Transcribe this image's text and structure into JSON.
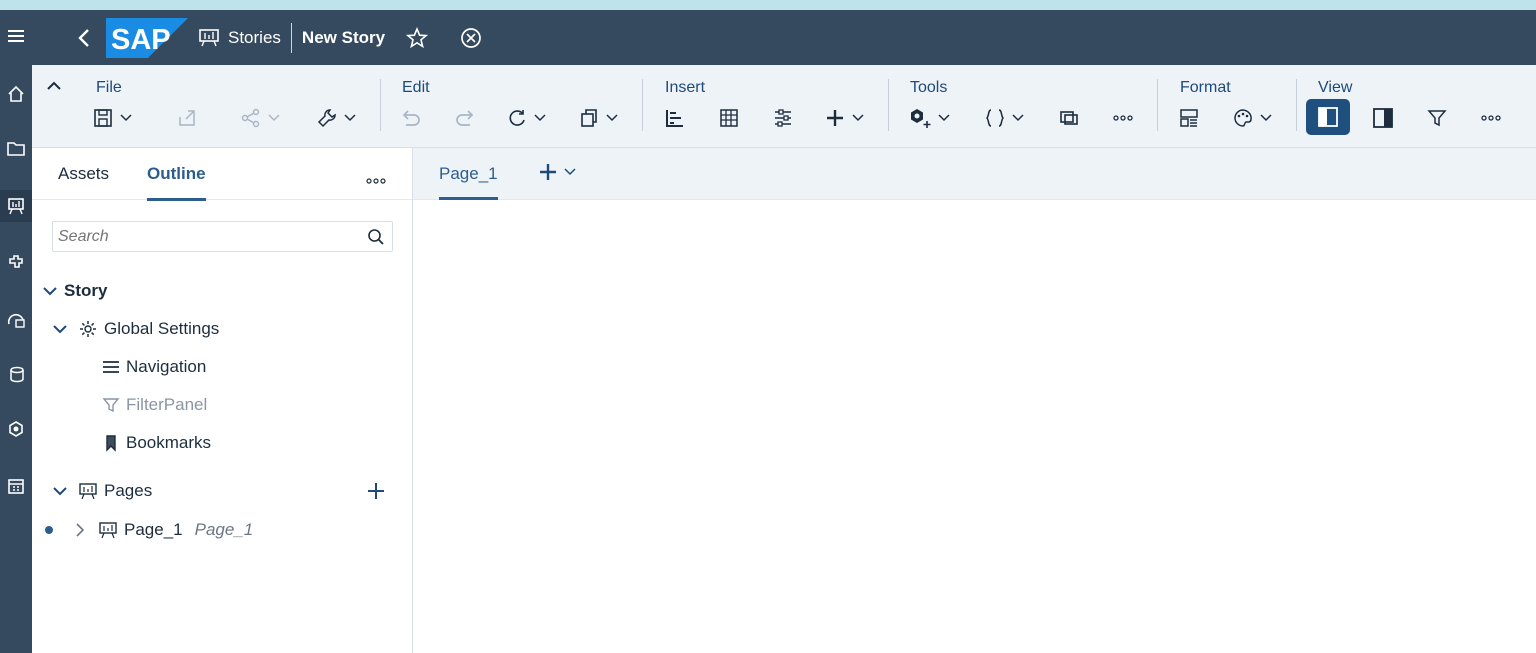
{
  "shell": {
    "breadcrumb": "Stories",
    "title": "New Story"
  },
  "toolbar": {
    "groups": {
      "file": "File",
      "edit": "Edit",
      "insert": "Insert",
      "tools": "Tools",
      "format": "Format",
      "view": "View"
    }
  },
  "left_panel": {
    "tabs": [
      "Assets",
      "Outline"
    ],
    "selected_tab": "Outline",
    "search_placeholder": "Search",
    "tree": {
      "story": "Story",
      "global_settings": "Global Settings",
      "navigation": "Navigation",
      "filter_panel": "FilterPanel",
      "bookmarks": "Bookmarks",
      "pages": "Pages",
      "page_1": "Page_1",
      "page_1_secondary": "Page_1"
    }
  },
  "page_tabs": {
    "active": "Page_1"
  },
  "colors": {
    "shell_bg": "#354a5f",
    "accent": "#2c5d8f",
    "toolbar_bg": "#eef3f8",
    "view_selected": "#1e4f7f"
  },
  "icons": [
    "menu-icon",
    "home-icon",
    "folder-icon",
    "stories-icon",
    "plugin-icon",
    "analytics-icon",
    "data-icon",
    "modeler-icon",
    "calendar-icon",
    "back-icon",
    "star-icon",
    "close-circle-icon"
  ]
}
